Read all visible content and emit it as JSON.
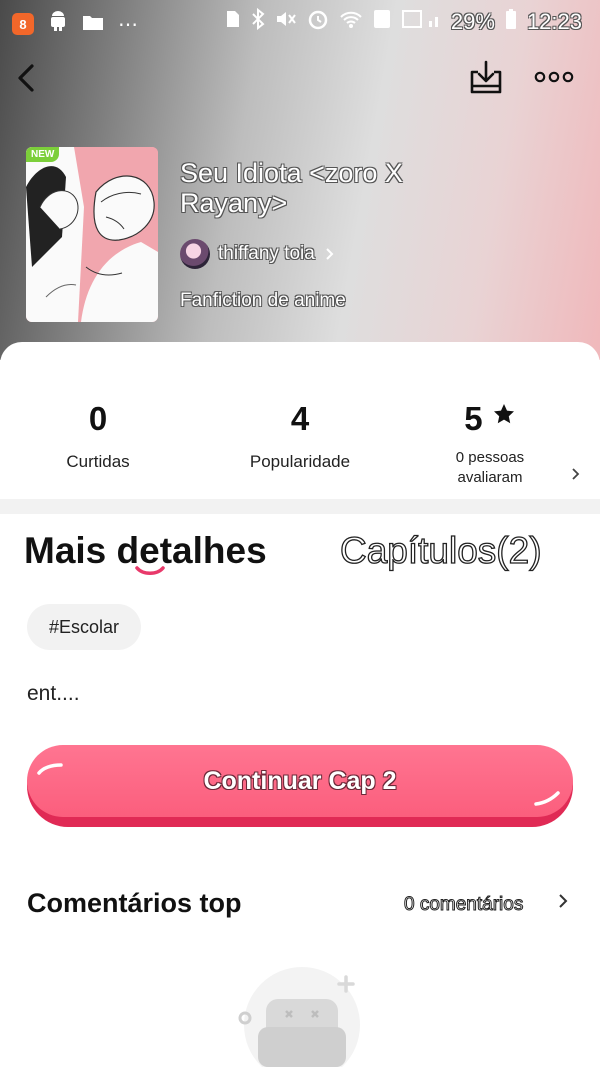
{
  "status_bar": {
    "battery": "29%",
    "time": "12:23",
    "app_badge": "8"
  },
  "story": {
    "title": "Seu Idiota <zoro X Rayany>",
    "badge": "NEW",
    "author": "thiffany toia",
    "category": "Fanfiction de anime"
  },
  "stats": [
    {
      "value": "0",
      "label": "Curtidas"
    },
    {
      "value": "4",
      "label": "Popularidade"
    },
    {
      "value": "5",
      "label": "0 pessoas avaliaram"
    }
  ],
  "tabs": {
    "active": "Mais detalhes",
    "inactive": "Capítulos(2)"
  },
  "tag": "#Escolar",
  "description": "ent....",
  "continue_button": "Continuar Cap 2",
  "comments": {
    "title": "Comentários top",
    "count": "0 comentários"
  },
  "colors": {
    "accent": "#fb5e7d",
    "accent_dark": "#e02a55",
    "new_badge": "#7ccf3a"
  }
}
